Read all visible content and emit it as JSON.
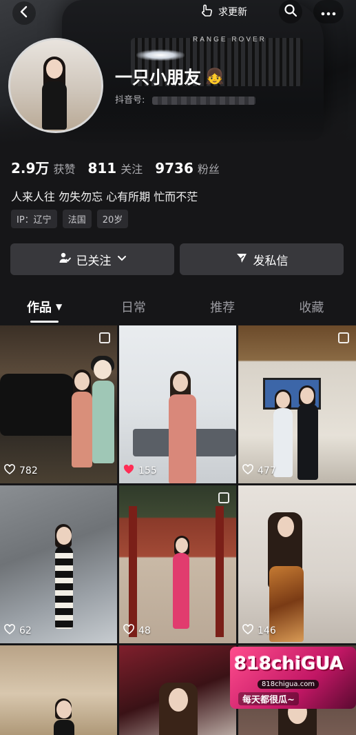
{
  "header": {
    "update_label": "求更新",
    "car_badge": "RANGE ROVER"
  },
  "profile": {
    "nickname": "一只小朋友",
    "nickname_emoji": "👧",
    "id_label": "抖音号:"
  },
  "stats": [
    {
      "num": "2.9万",
      "label": "获赞"
    },
    {
      "num": "811",
      "label": "关注"
    },
    {
      "num": "9736",
      "label": "粉丝"
    }
  ],
  "bio": "人来人往 勿失勿忘 心有所期 忙而不茫",
  "tags": [
    "IP：辽宁",
    "法国",
    "20岁"
  ],
  "actions": {
    "follow_label": "已关注",
    "message_label": "发私信"
  },
  "tabs": [
    "作品",
    "日常",
    "推荐",
    "收藏"
  ],
  "posts": [
    {
      "likes": "782",
      "liked": false,
      "pinned": true
    },
    {
      "likes": "155",
      "liked": true,
      "pinned": false
    },
    {
      "likes": "477",
      "liked": false,
      "pinned": true
    },
    {
      "likes": "62",
      "liked": false,
      "pinned": false
    },
    {
      "likes": "48",
      "liked": false,
      "pinned": true
    },
    {
      "likes": "146",
      "liked": false,
      "pinned": false
    }
  ],
  "ad": {
    "logo": "818chiGUA",
    "domain": "818chigua.com",
    "tagline": "每天都很瓜~"
  },
  "colors": {
    "background": "#161618",
    "liked_heart": "#ff2d55",
    "button_bg": "#38383c"
  }
}
